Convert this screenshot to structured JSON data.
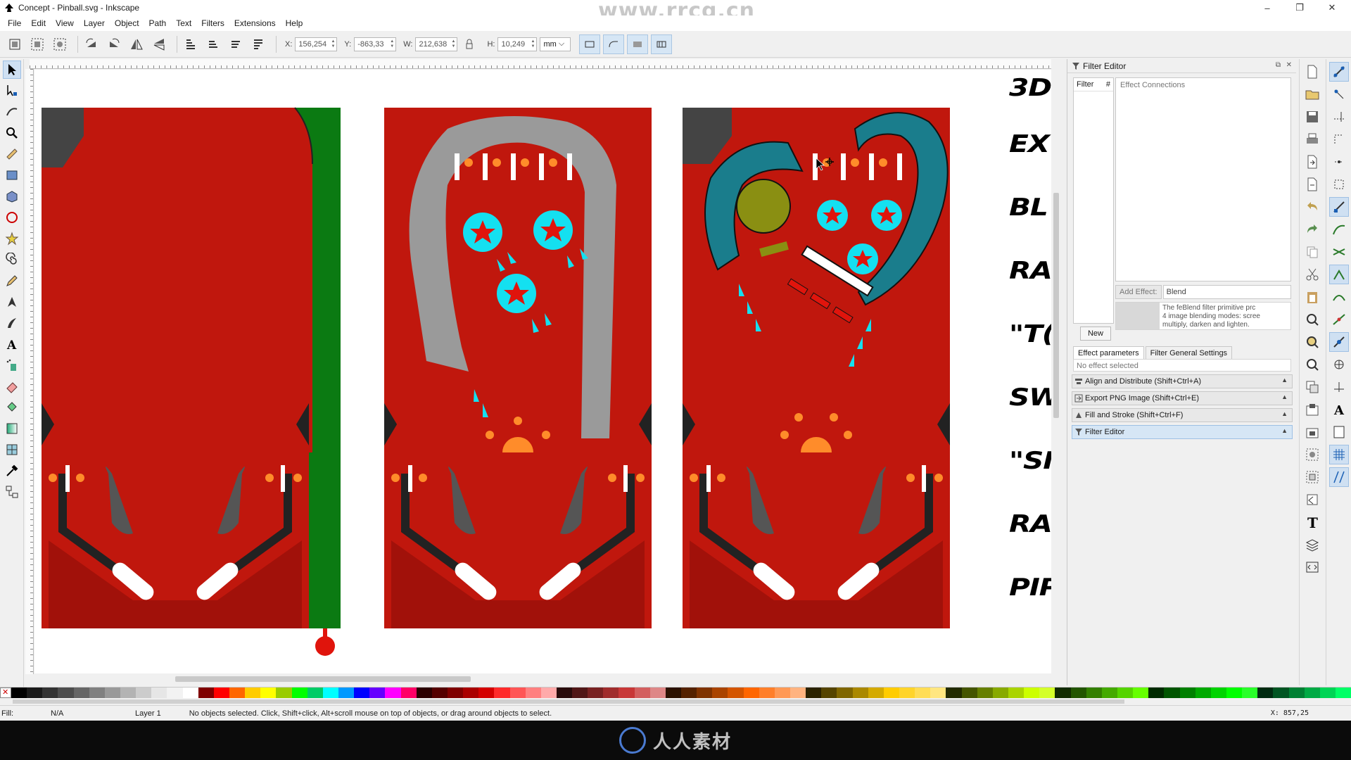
{
  "window": {
    "title": "Concept - Pinball.svg - Inkscape",
    "watermark_url": "www.rrcg.cn",
    "controls": [
      "–",
      "❐",
      "✕"
    ]
  },
  "menu": [
    "File",
    "Edit",
    "View",
    "Layer",
    "Object",
    "Path",
    "Text",
    "Filters",
    "Extensions",
    "Help"
  ],
  "controls": {
    "x_label": "X:",
    "x_value": "156,254",
    "y_label": "Y:",
    "y_value": "-863,33",
    "w_label": "W:",
    "w_value": "212,638",
    "h_label": "H:",
    "h_value": "10,249",
    "lock_icon": "lock-icon",
    "unit": "mm"
  },
  "canvas": {
    "side_texts": [
      "3D",
      "EX",
      "BL",
      "RA",
      "\"T(",
      "SW",
      "\"SI",
      "RA",
      "PIP"
    ],
    "colors": {
      "playfield": "#c0170d",
      "dark": "#3a3a3a",
      "green": "#0b7a12",
      "cyan": "#14e0f0",
      "teal": "#1a7d8c",
      "orange": "#ff8c2a",
      "olive": "#8a8f12",
      "gray": "#9a9a9a"
    }
  },
  "filter_editor": {
    "title": "Filter Editor",
    "filter_col": "Filter",
    "hash_col": "#",
    "effect_connections": "Effect Connections",
    "add_effect": "Add Effect:",
    "effect_combo": "Blend",
    "desc_line1": "The feBlend filter primitive prc",
    "desc_line2": "4 image blending modes: scree",
    "desc_line3": "multiply, darken and lighten.",
    "new_button": "New",
    "tab_params": "Effect parameters",
    "tab_general": "Filter General Settings",
    "no_effect": "No effect selected"
  },
  "dock_rows": [
    "Align and Distribute (Shift+Ctrl+A)",
    "Export PNG Image (Shift+Ctrl+E)",
    "Fill and Stroke (Shift+Ctrl+F)",
    "Filter Editor"
  ],
  "status": {
    "fill_label": "Fill:",
    "fill_value": "N/A",
    "message": "No objects selected. Click, Shift+click, Alt+scroll mouse on top of objects, or drag around objects to select.",
    "layer": "Layer 1",
    "coords": "X: 857,25"
  },
  "bottom_watermark": "人人素材"
}
